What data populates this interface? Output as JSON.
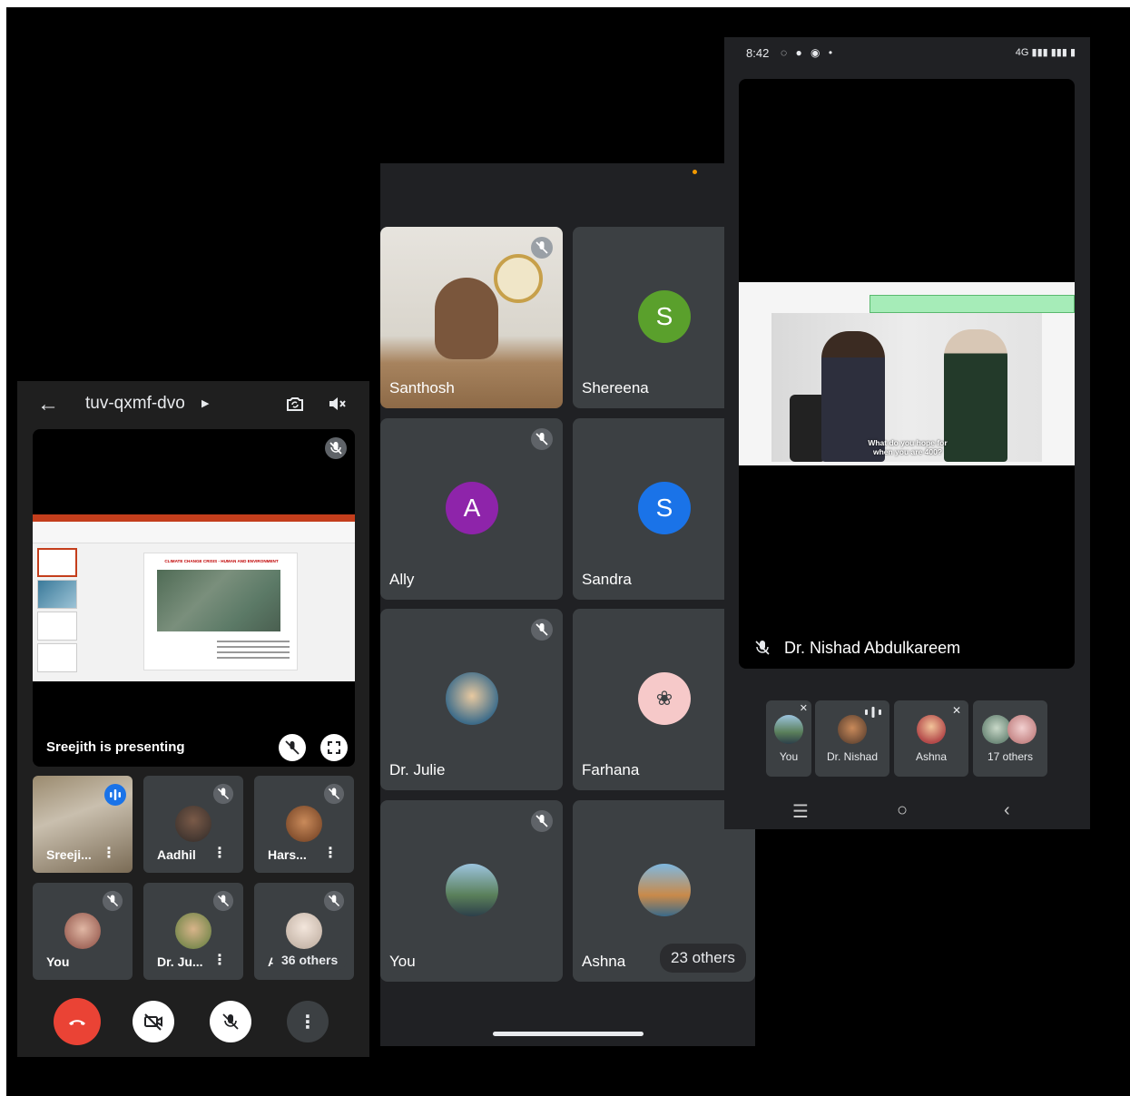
{
  "colors": {
    "background": "#000000",
    "tile": "#3c4043",
    "panel": "#202124",
    "end_call": "#ea4335",
    "avatar_shereena": "#5aa02c",
    "avatar_ally": "#8e24aa",
    "avatar_sandra": "#1a73e8",
    "avatar_farhana": "#f6c9c9"
  },
  "phone1": {
    "meeting_code": "tuv-qxmf-dvo",
    "presenting_text": "Sreejith is presenting",
    "slide_title": "CLIMATE CHANGE CRISIS - HUMAN AND ENVIRONMENT",
    "tiles": [
      {
        "name": "Sreeji...",
        "icon": "speaking-icon"
      },
      {
        "name": "Aadhil",
        "icon": "mic-off-icon"
      },
      {
        "name": "Hars...",
        "icon": "mic-off-icon"
      },
      {
        "name": "You",
        "icon": "mic-off-icon"
      },
      {
        "name": "Dr. Ju...",
        "icon": "mic-off-icon"
      },
      {
        "name": "A",
        "others": "36 others",
        "icon": "mic-off-icon"
      }
    ],
    "controls": [
      "end-call-icon",
      "camera-off-icon",
      "mic-off-icon",
      "more-vert-icon"
    ]
  },
  "phone2": {
    "tiles": [
      {
        "name": "Santhosh"
      },
      {
        "name": "Shereena",
        "initial": "S"
      },
      {
        "name": "Ally",
        "initial": "A"
      },
      {
        "name": "Sandra",
        "initial": "S"
      },
      {
        "name": "Dr. Julie"
      },
      {
        "name": "Farhana"
      },
      {
        "name": "You"
      },
      {
        "name": "Ashna",
        "others": "23 others"
      }
    ]
  },
  "phone3": {
    "status_time": "8:42",
    "status_right": "4G",
    "video_caption": "What do you hope for when you are 400?",
    "speaker_name": "Dr. Nishad Abdulkareem",
    "chips": [
      {
        "label": "You"
      },
      {
        "label": "Dr. Nishad"
      },
      {
        "label": "Ashna"
      },
      {
        "label": "17 others"
      }
    ]
  }
}
